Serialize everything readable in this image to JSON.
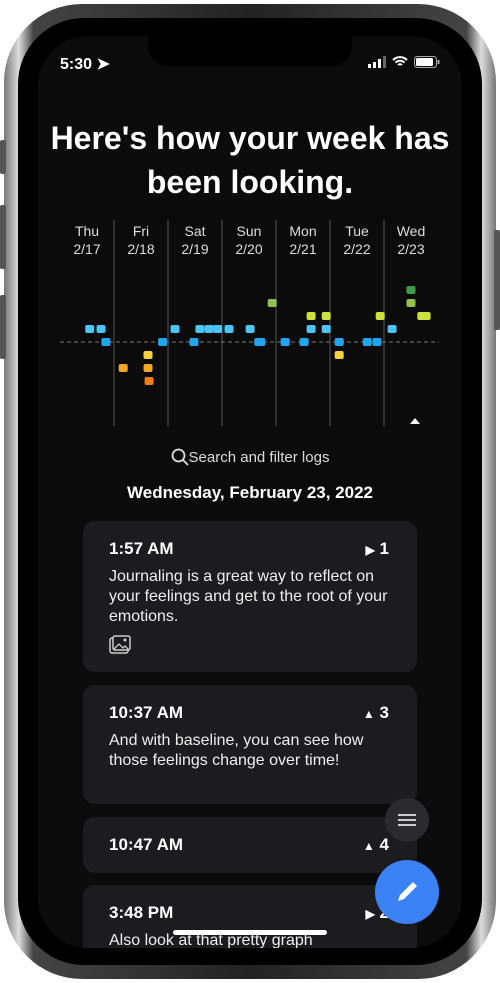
{
  "status": {
    "time": "5:30"
  },
  "headline": "Here's how your week has been looking.",
  "chart_data": {
    "type": "scatter",
    "days": [
      {
        "name": "Thu",
        "date": "2/17"
      },
      {
        "name": "Fri",
        "date": "2/18"
      },
      {
        "name": "Sat",
        "date": "2/19"
      },
      {
        "name": "Sun",
        "date": "2/20"
      },
      {
        "name": "Mon",
        "date": "2/21"
      },
      {
        "name": "Tue",
        "date": "2/22"
      },
      {
        "name": "Wed",
        "date": "2/23"
      }
    ],
    "ylim": [
      -4,
      5
    ],
    "baseline": 0,
    "colors": {
      "-3": "#f07c0f",
      "-2": "#f5a623",
      "-1": "#f8d23a",
      "0": "#1ea7f0",
      "1": "#4cc4f4",
      "2": "#cde13c",
      "3": "#8fc050",
      "4": "#3e9b48"
    },
    "points": [
      [
        0,
        0.55,
        1
      ],
      [
        0,
        0.76,
        1
      ],
      [
        0,
        0.85,
        0
      ],
      [
        1,
        0.17,
        -2
      ],
      [
        1,
        0.63,
        -2
      ],
      [
        1,
        0.63,
        -1
      ],
      [
        1,
        0.65,
        -3
      ],
      [
        1,
        0.9,
        0
      ],
      [
        2,
        0.13,
        1
      ],
      [
        2,
        0.48,
        0
      ],
      [
        2,
        0.59,
        1
      ],
      [
        2,
        0.76,
        1
      ],
      [
        2,
        0.92,
        1
      ],
      [
        3,
        0.13,
        1
      ],
      [
        3,
        0.52,
        1
      ],
      [
        3,
        0.68,
        0
      ],
      [
        3,
        0.72,
        0
      ],
      [
        3,
        0.93,
        3
      ],
      [
        4,
        0.17,
        0
      ],
      [
        4,
        0.52,
        0
      ],
      [
        4,
        0.65,
        2
      ],
      [
        4,
        0.65,
        1
      ],
      [
        4,
        0.93,
        2
      ],
      [
        4,
        0.93,
        1
      ],
      [
        5,
        0.17,
        0
      ],
      [
        5,
        0.17,
        -1
      ],
      [
        5,
        0.69,
        0
      ],
      [
        5,
        0.87,
        0
      ],
      [
        5,
        0.93,
        2
      ],
      [
        6,
        0.15,
        1
      ],
      [
        6,
        0.5,
        4
      ],
      [
        6,
        0.5,
        3
      ],
      [
        6,
        0.7,
        2
      ],
      [
        6,
        0.78,
        2
      ]
    ]
  },
  "search_label": "Search and filter logs",
  "selected_date": "Wednesday, February 23, 2022",
  "logs": [
    {
      "time": "1:57 AM",
      "mood": "1",
      "trend": "right",
      "text": "Journaling is a great way to reflect on your feelings and get to the root of your emotions."
    },
    {
      "time": "10:37 AM",
      "mood": "3",
      "trend": "up",
      "text": "And with baseline, you can see how those feelings change over time!"
    },
    {
      "time": "10:47 AM",
      "mood": "4",
      "trend": "up",
      "text": ""
    },
    {
      "time": "3:48 PM",
      "mood": "2",
      "trend": "right",
      "text": "Also look at that pretty graph"
    }
  ]
}
